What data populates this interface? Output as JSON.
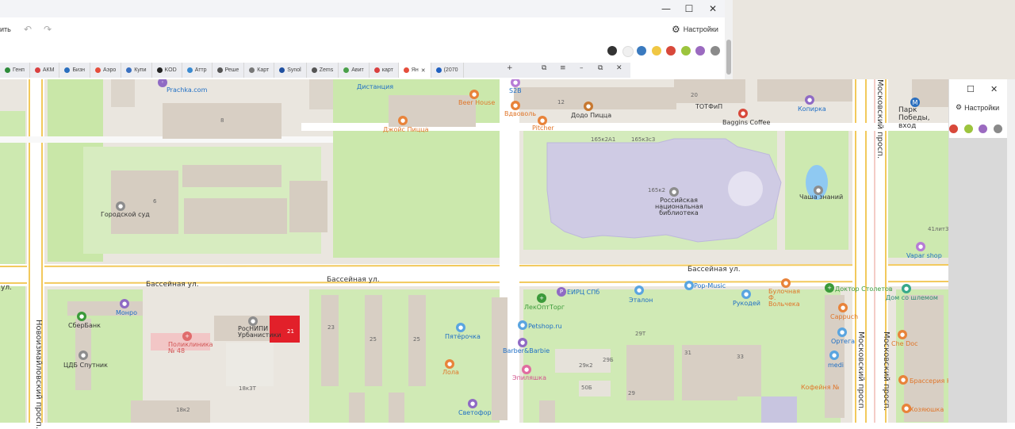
{
  "editor": {
    "toolbar_cut_label": "ить",
    "settings_label": "Настройки",
    "colors": [
      "#333333",
      "#f0f0f0",
      "#3a7abf",
      "#f0c744",
      "#d8483a",
      "#9cc43d",
      "#9b6ac0",
      "#8a8a8a"
    ]
  },
  "browser": {
    "tabs": [
      {
        "label": "Генп",
        "color": "#2e8b3b"
      },
      {
        "label": "АКМ",
        "color": "#d94040"
      },
      {
        "label": "Бизн",
        "color": "#2a6fbf"
      },
      {
        "label": "Аэро",
        "color": "#e54e3c"
      },
      {
        "label": "Купи",
        "color": "#3a70c0"
      },
      {
        "label": "KOD",
        "color": "#222222"
      },
      {
        "label": "Аттр",
        "color": "#3a8ad0"
      },
      {
        "label": "Реше",
        "color": "#555555"
      },
      {
        "label": "Карт",
        "color": "#777777"
      },
      {
        "label": "Synol",
        "color": "#2050a0"
      },
      {
        "label": "Zems",
        "color": "#555555"
      },
      {
        "label": "Авит",
        "color": "#4aa04a"
      },
      {
        "label": "карт",
        "color": "#d94040"
      },
      {
        "label": "Ян",
        "color": "#e54e3c",
        "active": true
      },
      {
        "label": "(2070",
        "color": "#2060c0"
      }
    ]
  },
  "mini": {
    "settings_label": "Настройки",
    "colors": [
      "#d8483a",
      "#9cc43d",
      "#9b6ac0",
      "#8a8a8a"
    ]
  },
  "map": {
    "streets": {
      "basseinaya_left": "Бассейная ул.",
      "basseinaya_mid": "Бассейная ул.",
      "basseinaya_right": "Бассейная ул.",
      "ul_left": "ул.",
      "novoizmailovsky": "Новоизмайловский просп.",
      "moskovsky_1": "Московский просп.",
      "moskovsky_2": "Московский просп.",
      "moskovsky_top": "Московский просп."
    },
    "pois": {
      "prachka": "Prachka.com",
      "distancia": "Дистанция",
      "beer_house": "Beer House",
      "s2b": "S2B",
      "vdvol": "Вдвоволь",
      "dzhois": "Джойс Пицца",
      "pitcher": "Pitcher",
      "dodo": "Додо Пицца",
      "totfip": "ТОТФиП",
      "kopirka": "Копирка",
      "baggins": "Baggins Coffee",
      "metro": "Парк Победы, вход",
      "gorodskoy_sud": "Городской суд",
      "rnb": "Российская национальная библиотека",
      "chasha": "Чаша знаний",
      "vapar": "Vapar shop",
      "monro": "Монро",
      "sberbank": "СберБанк",
      "poliklinika": "Поликлиника № 48",
      "cdb": "ЦДБ Спутник",
      "rosniipi": "РосНИПИ Урбанистики",
      "pyaterochka": "Пятёрочка",
      "lola": "Лола",
      "svetofor": "Светофор",
      "lekopttorg": "ЛекОптТорг",
      "eirc": "ЕИРЦ СПб",
      "etalon": "Эталон",
      "petshop": "Petshop.ru",
      "barber": "Barber&Barbie",
      "epilyashka": "Эпиляшка",
      "popmusic": "Pop-Music",
      "rukodei": "Рукодей",
      "bulochnaya": "Булочная Ф. Вольчека",
      "doktor": "Доктор Столетов",
      "cappuch": "Cappuch",
      "ortega": "Ортега",
      "medi": "medi",
      "dom_so_shlemom": "Дом со шлемом",
      "che_doc": "Che Doc",
      "kofeinya": "Кофейня №",
      "brasseria": "Брассерия Кр",
      "khozyushka": "Хозяюшка"
    },
    "buildings": {
      "b8": "8",
      "b6": "6",
      "b12": "12",
      "b20": "20",
      "b165k2a1": "165к2А1",
      "b165k3s3": "165к3с3",
      "b165k2": "165к2",
      "b41k3": "41лит3",
      "b23": "23",
      "b25": "25",
      "b29t": "29Т",
      "b29k2": "29к2",
      "b29b": "29Б",
      "b50b": "50Б",
      "b29": "29",
      "b31": "31",
      "b33": "33",
      "b18k3t": "18к3Т",
      "b18k2": "18к2"
    },
    "cluster_count": "21"
  }
}
